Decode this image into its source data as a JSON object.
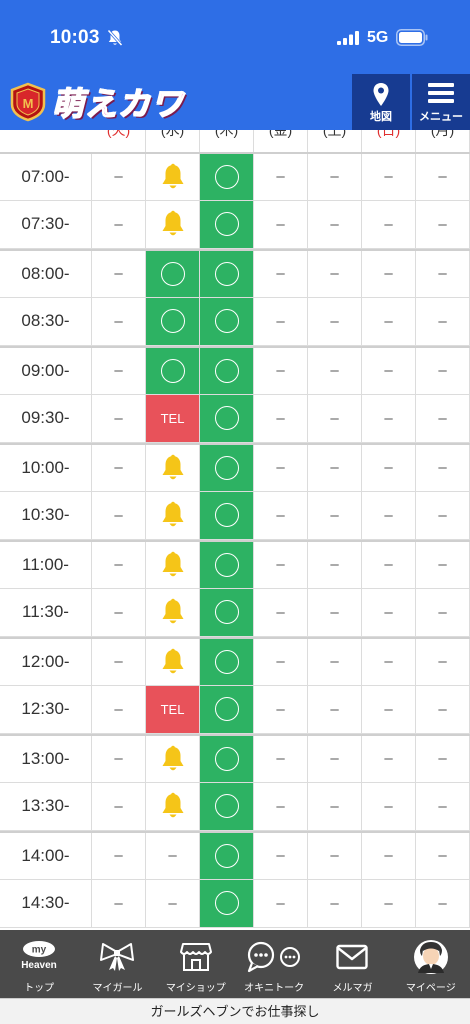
{
  "status_bar": {
    "time": "10:03",
    "network": "5G"
  },
  "header": {
    "logo_text": "萌えカワ",
    "map_label": "地図",
    "menu_label": "メニュー"
  },
  "schedule": {
    "days": [
      "(火)",
      "(水)",
      "(木)",
      "(金)",
      "(土)",
      "(日)",
      "(月)"
    ],
    "day_colors": [
      "#e03030",
      "#333333",
      "#333333",
      "#333333",
      "#333333",
      "#e03030",
      "#333333"
    ],
    "rows": [
      {
        "time": "07:00-",
        "cells": [
          "–",
          "bell",
          "circle",
          "–",
          "–",
          "–",
          "–"
        ]
      },
      {
        "time": "07:30-",
        "cells": [
          "–",
          "bell",
          "circle",
          "–",
          "–",
          "–",
          "–"
        ]
      },
      {
        "time": "08:00-",
        "cells": [
          "–",
          "circle",
          "circle",
          "–",
          "–",
          "–",
          "–"
        ]
      },
      {
        "time": "08:30-",
        "cells": [
          "–",
          "circle",
          "circle",
          "–",
          "–",
          "–",
          "–"
        ]
      },
      {
        "time": "09:00-",
        "cells": [
          "–",
          "circle",
          "circle",
          "–",
          "–",
          "–",
          "–"
        ]
      },
      {
        "time": "09:30-",
        "cells": [
          "–",
          "TEL",
          "circle",
          "–",
          "–",
          "–",
          "–"
        ]
      },
      {
        "time": "10:00-",
        "cells": [
          "–",
          "bell",
          "circle",
          "–",
          "–",
          "–",
          "–"
        ]
      },
      {
        "time": "10:30-",
        "cells": [
          "–",
          "bell",
          "circle",
          "–",
          "–",
          "–",
          "–"
        ]
      },
      {
        "time": "11:00-",
        "cells": [
          "–",
          "bell",
          "circle",
          "–",
          "–",
          "–",
          "–"
        ]
      },
      {
        "time": "11:30-",
        "cells": [
          "–",
          "bell",
          "circle",
          "–",
          "–",
          "–",
          "–"
        ]
      },
      {
        "time": "12:00-",
        "cells": [
          "–",
          "bell",
          "circle",
          "–",
          "–",
          "–",
          "–"
        ]
      },
      {
        "time": "12:30-",
        "cells": [
          "–",
          "TEL",
          "circle",
          "–",
          "–",
          "–",
          "–"
        ]
      },
      {
        "time": "13:00-",
        "cells": [
          "–",
          "bell",
          "circle",
          "–",
          "–",
          "–",
          "–"
        ]
      },
      {
        "time": "13:30-",
        "cells": [
          "–",
          "bell",
          "circle",
          "–",
          "–",
          "–",
          "–"
        ]
      },
      {
        "time": "14:00-",
        "cells": [
          "–",
          "–",
          "circle",
          "–",
          "–",
          "–",
          "–"
        ]
      },
      {
        "time": "14:30-",
        "cells": [
          "–",
          "–",
          "circle",
          "–",
          "–",
          "–",
          "–"
        ]
      }
    ]
  },
  "bottom_nav": {
    "items": [
      {
        "label": "トップ",
        "icon": "my-heaven-icon",
        "logo_top": "my",
        "logo_bottom": "Heaven"
      },
      {
        "label": "マイガール",
        "icon": "ribbon-icon"
      },
      {
        "label": "マイショップ",
        "icon": "shop-icon"
      },
      {
        "label": "オキニトーク",
        "icon": "chat-bubbles-icon"
      },
      {
        "label": "メルマガ",
        "icon": "mail-icon"
      },
      {
        "label": "マイページ",
        "icon": "avatar-icon"
      }
    ]
  },
  "footer": {
    "text": "ガールズヘブンでお仕事探し"
  },
  "colors": {
    "brand_blue": "#2e6ee6",
    "header_button": "#173b91",
    "available_green": "#2db263",
    "tel_red": "#e8525a",
    "bell_yellow": "#f5c518",
    "nav_bg": "#4a4a4a"
  }
}
